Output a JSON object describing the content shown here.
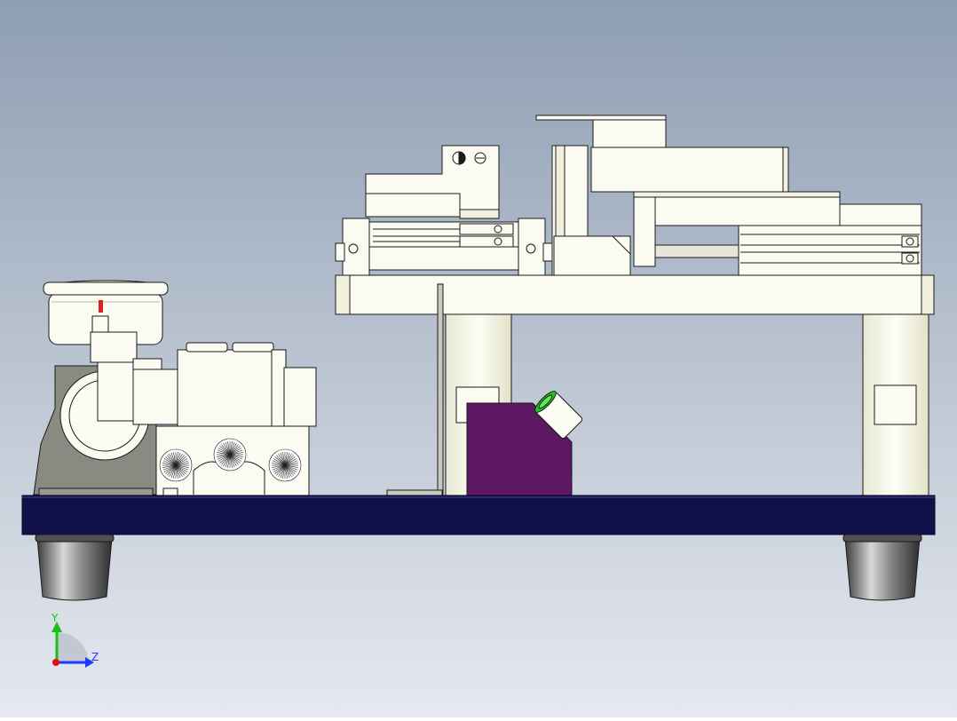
{
  "viewport": {
    "background_top": "#8e9eb3",
    "background_bottom": "#e6e9ef"
  },
  "colors": {
    "part_fill": "#fbfbf2",
    "part_cream": "#f2f2e0",
    "outline": "#1a1a1a",
    "base_plate": "#10104a",
    "purple_block": "#5e1763",
    "green_lens": "#22c51f",
    "gray_housing": "#8a8a82",
    "foot_metal": "#6e6e6e",
    "red_marker": "#e02020"
  },
  "axis_triad": {
    "y_label": "Y",
    "z_label": "Z",
    "y_color": "#18c018",
    "z_color": "#1c3cff",
    "origin_color": "#e01010"
  }
}
